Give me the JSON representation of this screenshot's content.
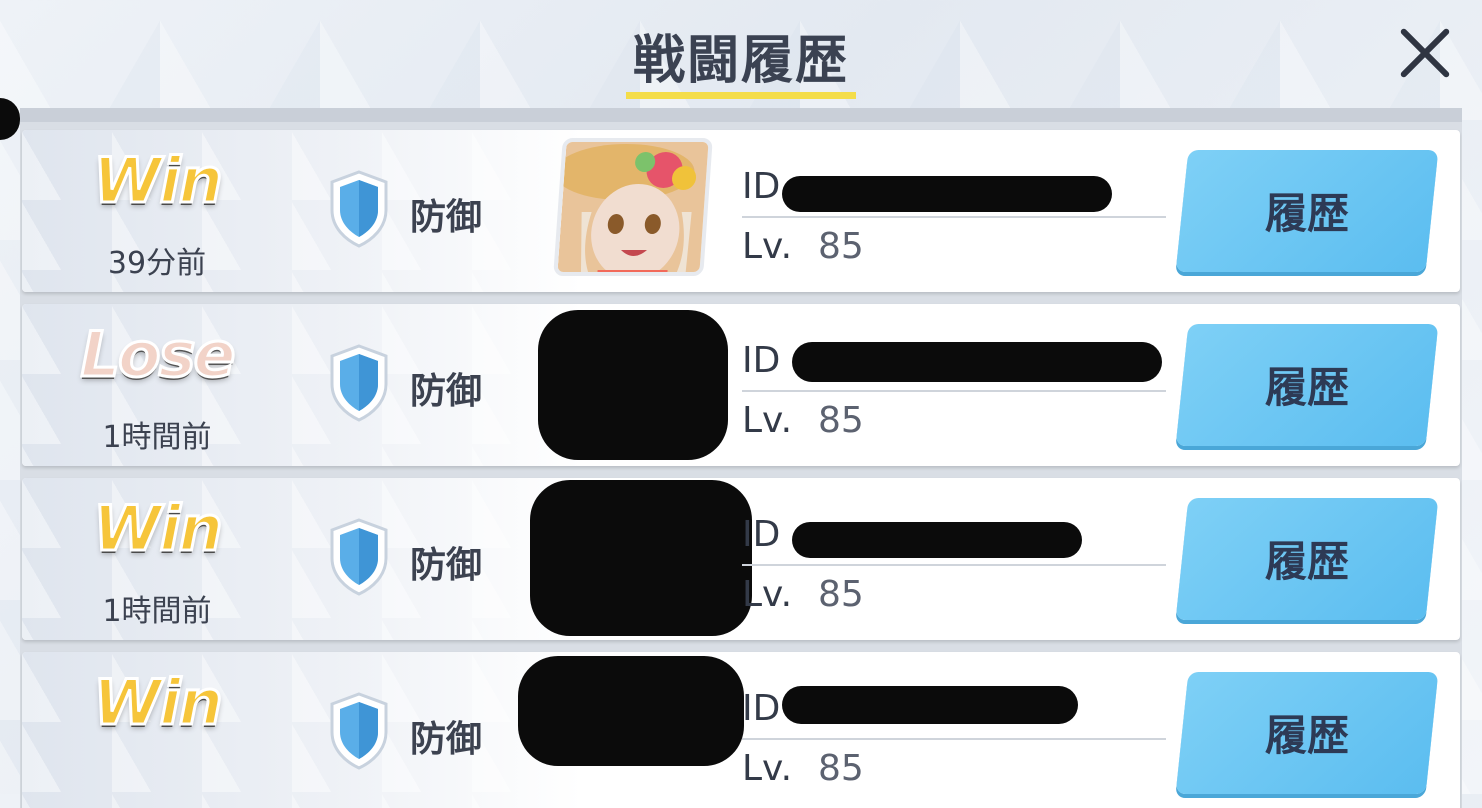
{
  "header": {
    "title": "戦闘履歴",
    "close_icon": "close-icon"
  },
  "colors": {
    "win": "#f6c53a",
    "lose": "#f2d3c8",
    "button": "#6cc6f3",
    "underline": "#f4dd4a"
  },
  "rows": [
    {
      "result": "Win",
      "time": "39分前",
      "mode": "防御",
      "id_label": "ID",
      "lv_label": "Lv.",
      "level": "85",
      "button": "履歴",
      "avatar_visible": true
    },
    {
      "result": "Lose",
      "time": "1時間前",
      "mode": "防御",
      "id_label": "ID",
      "lv_label": "Lv.",
      "level": "85",
      "button": "履歴",
      "avatar_visible": false
    },
    {
      "result": "Win",
      "time": "1時間前",
      "mode": "防御",
      "id_label": "ID",
      "lv_label": "Lv.",
      "level": "85",
      "button": "履歴",
      "avatar_visible": false
    },
    {
      "result": "Win",
      "time": "",
      "mode": "防御",
      "id_label": "ID",
      "lv_label": "Lv.",
      "level": "85",
      "button": "履歴",
      "avatar_visible": false
    }
  ]
}
